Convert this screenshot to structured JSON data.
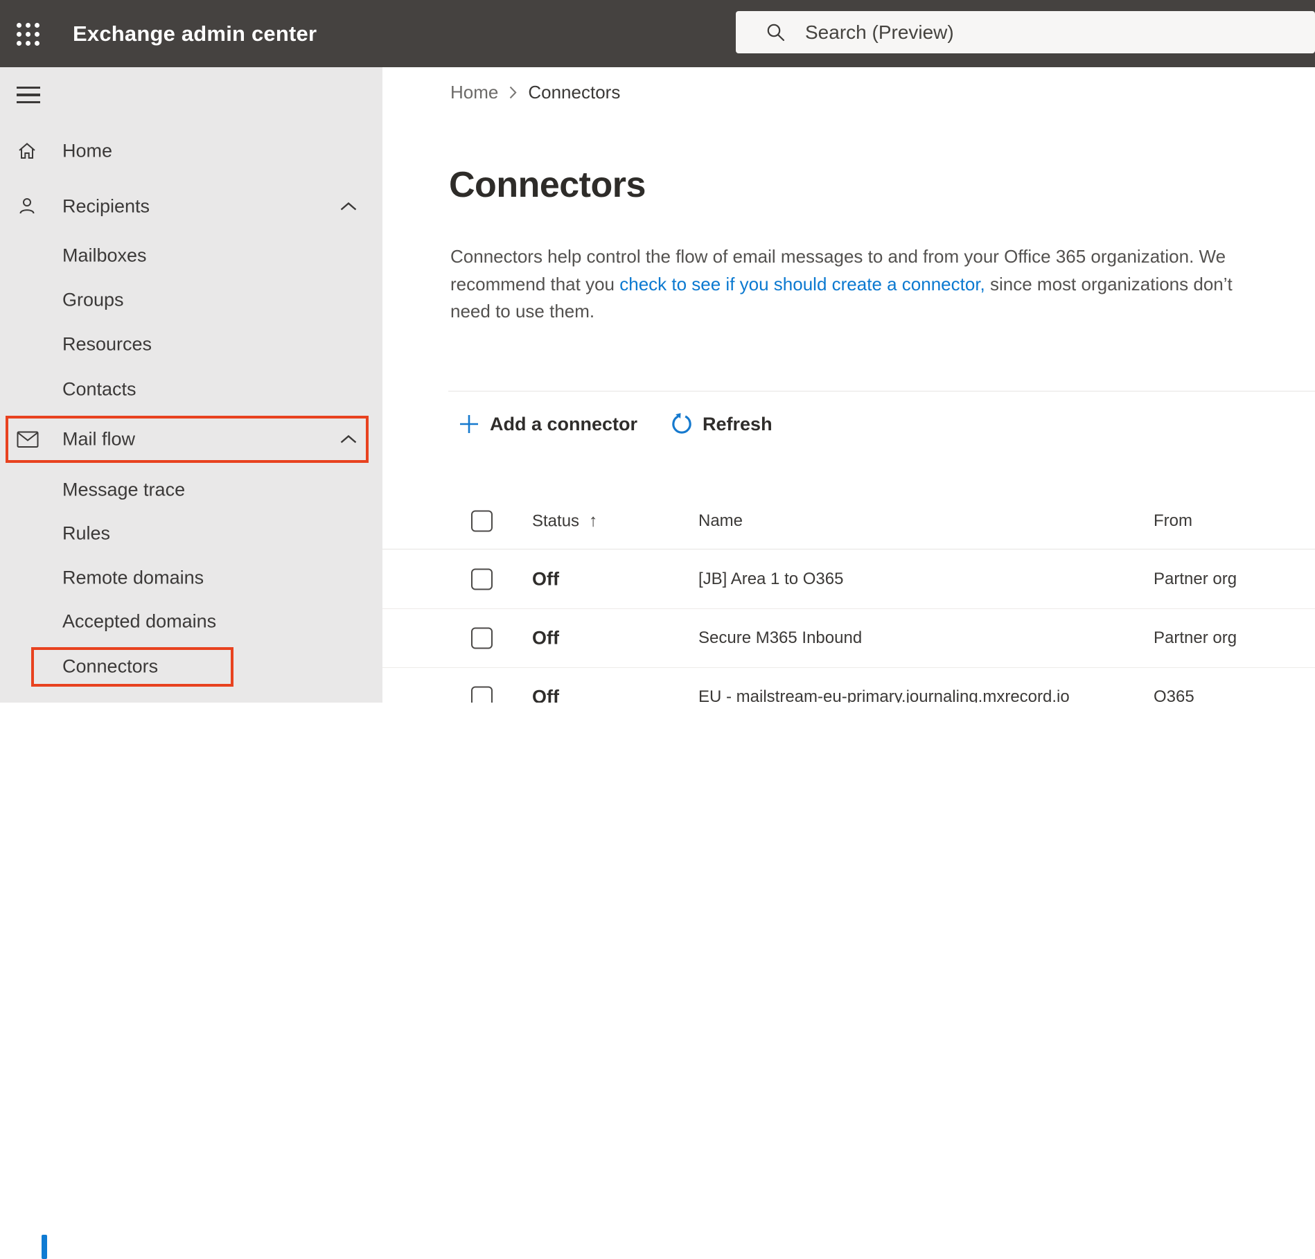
{
  "colors": {
    "topbar_bg": "#454240",
    "sidebar_bg": "#e9e8e8",
    "accent_blue": "#0f7bd3",
    "link_blue": "#0b79d0",
    "annotation_red": "#e8421f"
  },
  "topbar": {
    "title": "Exchange admin center",
    "search": {
      "placeholder": "Search (Preview)",
      "icon": "magnifier"
    }
  },
  "sidebar": {
    "items": [
      {
        "label": "Home",
        "icon": "home"
      },
      {
        "label": "Recipients",
        "icon": "person",
        "expanded": true
      },
      {
        "label": "Mailboxes"
      },
      {
        "label": "Groups"
      },
      {
        "label": "Resources"
      },
      {
        "label": "Contacts"
      },
      {
        "label": "Mail flow",
        "icon": "envelope",
        "expanded": true,
        "annotated": true
      },
      {
        "label": "Message trace"
      },
      {
        "label": "Rules"
      },
      {
        "label": "Remote domains"
      },
      {
        "label": "Accepted domains"
      },
      {
        "label": "Connectors",
        "selected": true,
        "annotated": true
      }
    ]
  },
  "breadcrumb": {
    "home": "Home",
    "current": "Connectors"
  },
  "page": {
    "title": "Connectors",
    "description": {
      "line1": "Connectors help control the flow of email messages to and from your Office 365 organization. We",
      "line2_before_link": "recommend that you ",
      "link_text": "check to see if you should create a connector,",
      "line2_after_link": " since most organizations don’t",
      "line3": "need to use them."
    }
  },
  "toolbar": {
    "add_label": "Add a connector",
    "refresh_label": "Refresh"
  },
  "table": {
    "headers": {
      "status": "Status",
      "name": "Name",
      "from": "From",
      "sort_ascending_icon": "↑"
    },
    "rows": [
      {
        "status": "Off",
        "name": "[JB] Area 1 to O365",
        "from": "Partner org"
      },
      {
        "status": "Off",
        "name": "Secure M365 Inbound",
        "from": "Partner org"
      },
      {
        "status": "Off",
        "name": "EU - mailstream-eu-primary.journaling.mxrecord.io",
        "from": "O365"
      }
    ]
  }
}
